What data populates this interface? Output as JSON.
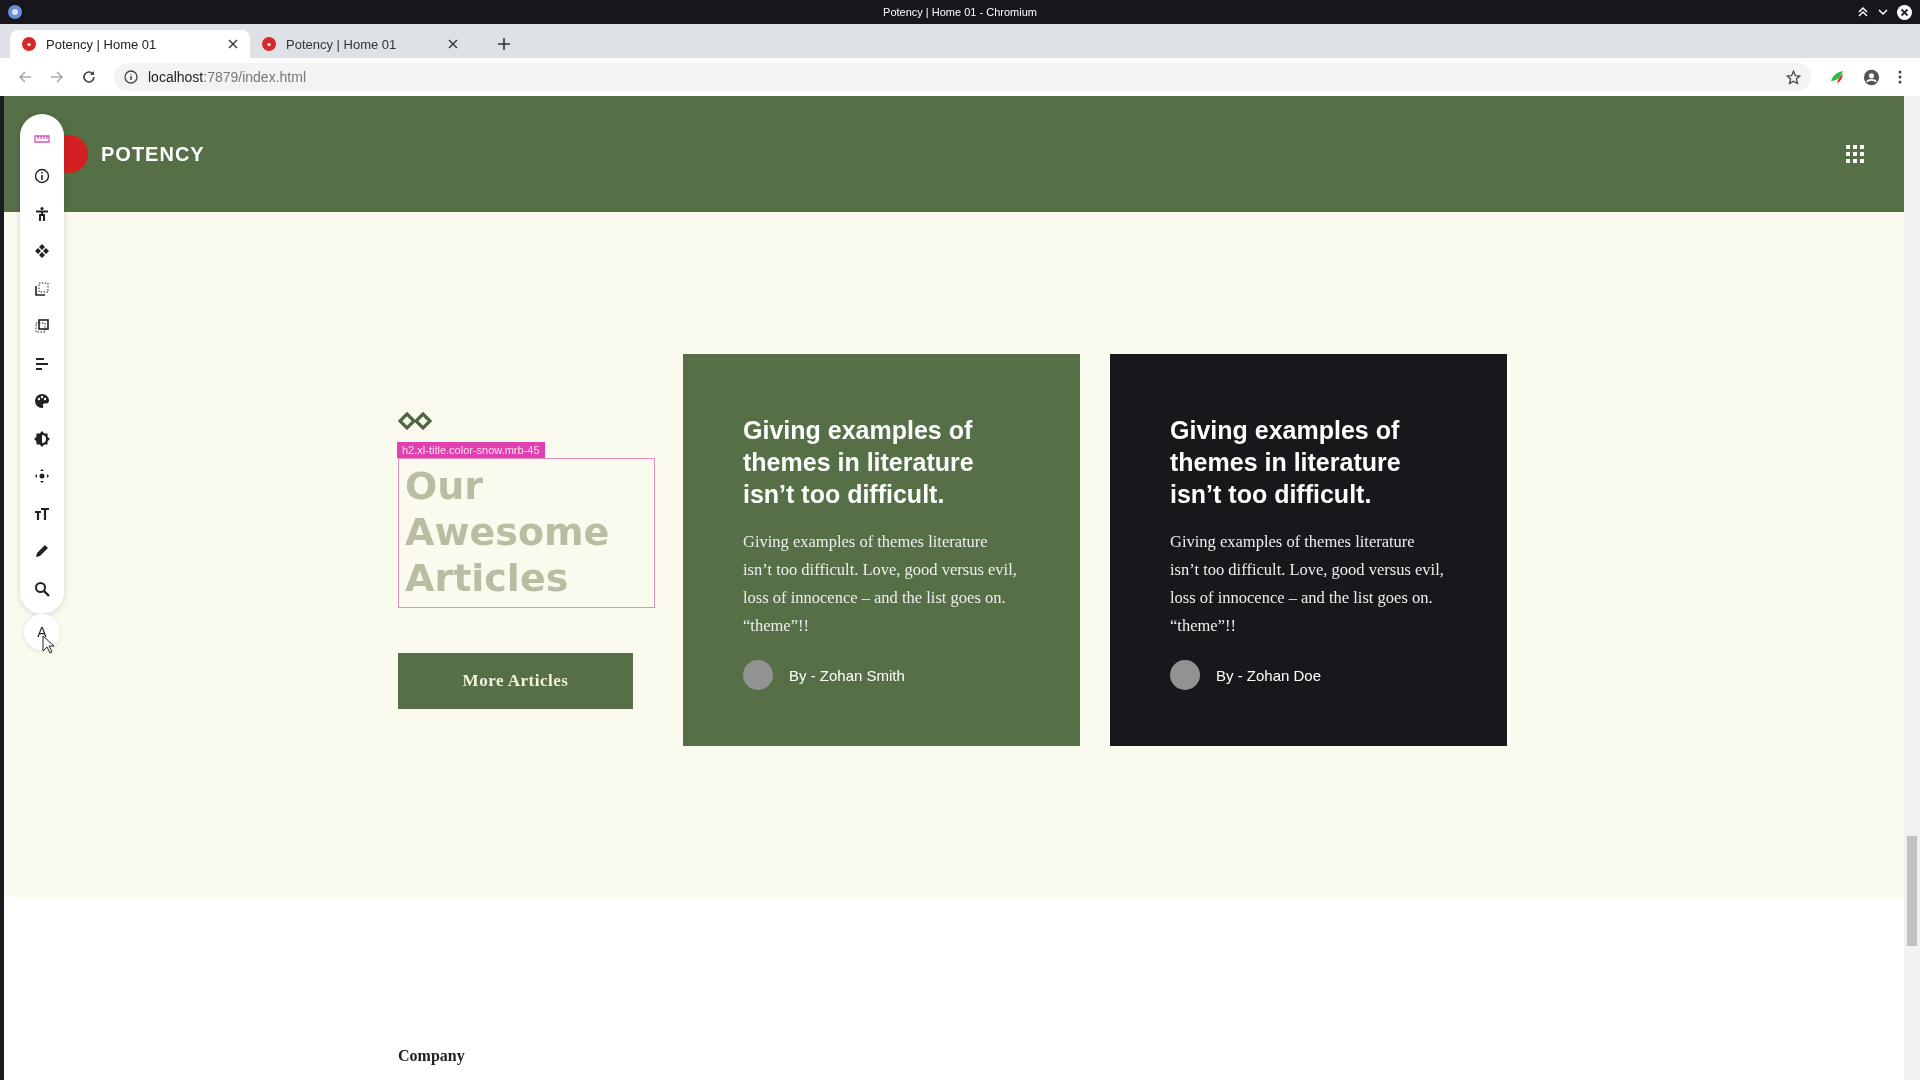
{
  "window": {
    "title": "Potency | Home 01 - Chromium"
  },
  "tabs": [
    {
      "label": "Potency | Home 01",
      "selected": true
    },
    {
      "label": "Potency | Home 01",
      "selected": false
    }
  ],
  "address_bar": {
    "host": "localhost",
    "path": ":7879/index.html"
  },
  "site_header": {
    "brand": "POTENCY"
  },
  "inspector_toolbar": {
    "tools": [
      {
        "kind": "ruler",
        "selected": true
      },
      {
        "kind": "info",
        "selected": false
      },
      {
        "kind": "figure",
        "selected": false
      },
      {
        "kind": "dots",
        "selected": false
      },
      {
        "kind": "copy",
        "selected": false
      },
      {
        "kind": "select",
        "selected": false
      },
      {
        "kind": "align",
        "selected": false
      },
      {
        "kind": "palette",
        "selected": false
      },
      {
        "kind": "contrast",
        "selected": false
      },
      {
        "kind": "move",
        "selected": false
      },
      {
        "kind": "textsize",
        "selected": false
      },
      {
        "kind": "pencil",
        "selected": false
      },
      {
        "kind": "search",
        "selected": false
      }
    ],
    "font_button": "A"
  },
  "inspector_overlay": {
    "label": "h2.xl-title.color-snow.mrb-45"
  },
  "section": {
    "title": "Our Awesome Articles",
    "button": "More Articles"
  },
  "articles": [
    {
      "kind": "green",
      "title": "Giving examples of themes in literature isn’t too difficult.",
      "body": "Giving examples of themes literature isn’t too difficult. Love, good versus evil, loss of innocence – and the list goes on. “theme”!!",
      "author": "By - Zohan Smith"
    },
    {
      "kind": "dark",
      "title": "Giving examples of themes in literature isn’t too difficult.",
      "body": "Giving examples of themes literature isn’t too difficult. Love, good versus evil, loss of innocence – and the list goes on. “theme”!!",
      "author": "By - Zohan Doe"
    }
  ],
  "footer": {
    "heading": "Company"
  }
}
